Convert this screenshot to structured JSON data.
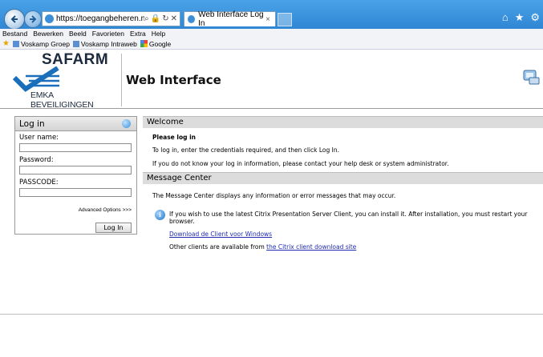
{
  "browser": {
    "url": "https://toegangbeheren.nl",
    "tab_title": "Web Interface Log In",
    "menu": [
      "Bestand",
      "Bewerken",
      "Beeld",
      "Favorieten",
      "Extra",
      "Help"
    ],
    "favorites": [
      "Voskamp Groep",
      "Voskamp Intraweb",
      "Google"
    ]
  },
  "header": {
    "logo_name": "SAFARM",
    "logo_sub": "EMKA BEVEILIGINGEN",
    "title": "Web Interface"
  },
  "login": {
    "title": "Log in",
    "username_label": "User name:",
    "password_label": "Password:",
    "passcode_label": "PASSCODE:",
    "advanced": "Advanced Options >>>",
    "button": "Log In"
  },
  "welcome": {
    "heading": "Welcome",
    "bold": "Please log in",
    "line1": "To log in, enter the credentials required, and then click Log In.",
    "line2": "If you do not know your log in information, please contact your help desk or system administrator."
  },
  "messages": {
    "heading": "Message Center",
    "line1": "The Message Center displays any information or error messages that may occur.",
    "info1": "If you wish to use the latest Citrix Presentation Server Client, you can install it. After installation, you must restart your",
    "info2": "browser.",
    "download_link": "Download de Client voor Windows",
    "other_prefix": "Other clients are available from ",
    "other_link": "the Citrix client download site"
  }
}
